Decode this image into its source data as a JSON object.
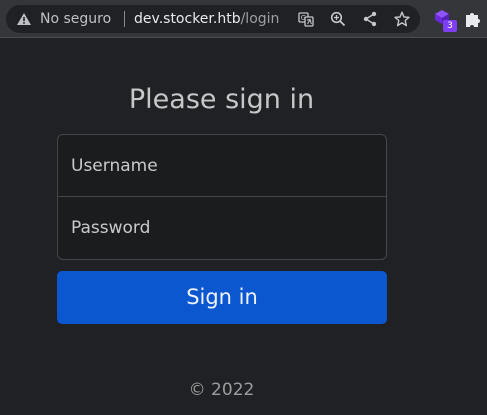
{
  "browser": {
    "security_label": "No seguro",
    "url_host": "dev.stocker.htb",
    "url_path": "/login",
    "icons": {
      "security": "warning-icon",
      "translate": "translate-icon",
      "zoom": "zoom-icon",
      "share": "share-icon",
      "bookmark": "star-icon",
      "extension": "extension-icon",
      "extensions_menu": "puzzle-icon"
    },
    "extension_badge": "3"
  },
  "login": {
    "title": "Please sign in",
    "username_placeholder": "Username",
    "password_placeholder": "Password",
    "submit_label": "Sign in"
  },
  "footer": {
    "copyright": "© 2022"
  },
  "colors": {
    "background": "#202124",
    "button": "#0b57d0",
    "extension_badge": "#7e3ff2"
  }
}
